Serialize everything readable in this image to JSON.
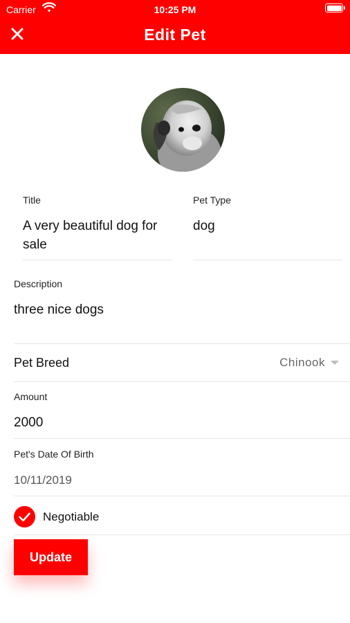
{
  "colors": {
    "brand": "#ff0000",
    "header_text": "#ffffff"
  },
  "status_bar": {
    "carrier": "Carrier",
    "time": "10:25 PM"
  },
  "header": {
    "title": "Edit Pet",
    "close_icon": "close-icon"
  },
  "avatar": {
    "icon": "pet-photo-avatar"
  },
  "form": {
    "title": {
      "label": "Title",
      "value": "A very beautiful dog for sale"
    },
    "pet_type": {
      "label": "Pet Type",
      "value": "dog"
    },
    "description": {
      "label": "Description",
      "value": "three nice dogs"
    },
    "pet_breed": {
      "label": "Pet Breed",
      "value": "Chinook"
    },
    "amount": {
      "label": "Amount",
      "value": "2000"
    },
    "date_of_birth": {
      "label": "Pet's Date Of Birth",
      "value": "10/11/2019"
    },
    "negotiable": {
      "label": "Negotiable",
      "checked": true
    }
  },
  "actions": {
    "update_label": "Update"
  }
}
